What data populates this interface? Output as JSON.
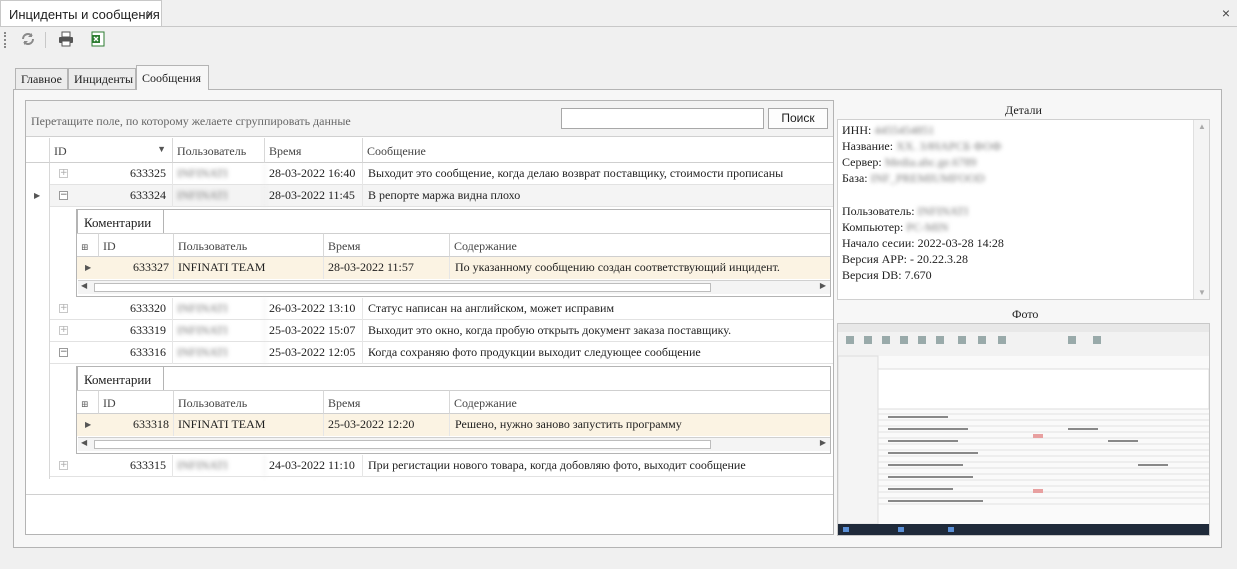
{
  "window": {
    "tab_title": "Инциденты и сообщения",
    "tab_close": "×",
    "window_close": "×"
  },
  "toolbar": {
    "refresh": "refresh-icon",
    "print": "print-icon",
    "excel": "excel-export-icon"
  },
  "tabs": [
    {
      "label": "Главное"
    },
    {
      "label": "Инциденты"
    },
    {
      "label": "Сообщения",
      "active": true
    }
  ],
  "grid": {
    "group_hint": "Перетащите поле, по которому желаете сгруппировать данные",
    "search_button": "Поиск",
    "columns": {
      "id": "ID",
      "user": "Пользователь",
      "time": "Время",
      "message": "Сообщение"
    },
    "rows": [
      {
        "id": "633325",
        "user": "INFINATI",
        "time": "28-03-2022 16:40",
        "message": "Выходит это сообщение, когда делаю возврат поставщику, стоимости прописаны"
      },
      {
        "id": "633324",
        "user": "INFINATI",
        "time": "28-03-2022 11:45",
        "message": "В репорте маржа видна плохо"
      },
      {
        "id": "633320",
        "user": "INFINATI",
        "time": "26-03-2022 13:10",
        "message": "Статус написан на английском, может исправим"
      },
      {
        "id": "633319",
        "user": "INFINATI",
        "time": "25-03-2022 15:07",
        "message": "Выходит это окно, когда пробую открыть документ заказа поставщику."
      },
      {
        "id": "633316",
        "user": "INFINATI",
        "time": "25-03-2022 12:05",
        "message": "Когда сохраняю фото продукции выходит следующее сообщение"
      },
      {
        "id": "633315",
        "user": "INFINATI",
        "time": "24-03-2022 11:10",
        "message": "При регистации нового товара, когда добовляю фото, выходит сообщение"
      }
    ],
    "details": [
      {
        "tab": "Коментарии",
        "columns": {
          "id": "ID",
          "user": "Пользователь",
          "time": "Время",
          "content": "Содержание"
        },
        "row": {
          "id": "633327",
          "user": "INFINATI TEAM",
          "time": "28-03-2022 11:57",
          "content": "По указанному сообщению создан соответствующий инцидент."
        }
      },
      {
        "tab": "Коментарии",
        "columns": {
          "id": "ID",
          "user": "Пользователь",
          "time": "Время",
          "content": "Содержание"
        },
        "row": {
          "id": "633318",
          "user": "INFINATI TEAM",
          "time": "25-03-2022 12:20",
          "content": "Решено, нужно заново запустить программу"
        }
      }
    ]
  },
  "details_panel": {
    "title": "Детали",
    "inn_label": "ИНН:",
    "inn_value": "4455454851",
    "name_label": "Название:",
    "name_value": "ХХ. ЗАЧАРСБ ФОФ",
    "server_label": "Сервер:",
    "server_value": "Media.abc.ge.6789",
    "db_label": "База:",
    "db_value": "INF_PREMIUMFOOD",
    "user_label": "Пользователь:",
    "user_value": "INFINATI",
    "computer_label": "Компьютер:",
    "computer_value": "PC-MIN",
    "session_label": "Начало сесии:",
    "session_value": "2022-03-28 14:28",
    "app_label": "Версия APP:",
    "app_value": "-   20.22.3.28",
    "db_version_label": "Версия DB:",
    "db_version_value": "7.670"
  },
  "photo_panel": {
    "title": "Фото"
  },
  "colors": {
    "selected_row": "#fbf3e3",
    "accent": "#c0392b"
  }
}
